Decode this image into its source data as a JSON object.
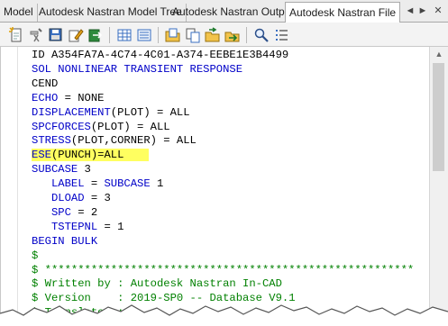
{
  "tabs": [
    {
      "label": "Model"
    },
    {
      "label": "Autodesk Nastran Model Tree"
    },
    {
      "label": "Autodesk Nastran Output"
    },
    {
      "label": "Autodesk Nastran File"
    }
  ],
  "tab_controls": {
    "prev": "◄",
    "next": "►",
    "close": "✕"
  },
  "toolbar": {
    "icons": [
      "new-file-icon",
      "run-analysis-icon",
      "save-icon",
      "edit-icon",
      "export-icon",
      "table-view-icon",
      "list-view-icon",
      "open-folder-icon",
      "copy-icon",
      "import-icon",
      "export-arrow-icon",
      "find-icon",
      "list-icon"
    ]
  },
  "editor": {
    "lines": [
      [
        {
          "t": "ID A354FA7A-4C74-4C01-A374-EEBE1E3B4499",
          "c": "plain"
        }
      ],
      [
        {
          "t": "SOL NONLINEAR TRANSIENT RESPONSE",
          "c": "kw"
        }
      ],
      [
        {
          "t": "CEND",
          "c": "plain"
        }
      ],
      [
        {
          "t": "ECHO",
          "c": "kw"
        },
        {
          "t": " = NONE",
          "c": "plain"
        }
      ],
      [
        {
          "t": "DISPLACEMENT",
          "c": "kw"
        },
        {
          "t": "(PLOT) = ALL",
          "c": "plain"
        }
      ],
      [
        {
          "t": "SPCFORCES",
          "c": "kw"
        },
        {
          "t": "(PLOT) = ALL",
          "c": "plain"
        }
      ],
      [
        {
          "t": "STRESS",
          "c": "kw"
        },
        {
          "t": "(PLOT,CORNER) = ALL",
          "c": "plain"
        }
      ],
      [
        {
          "t": "ESE",
          "c": "kw"
        },
        {
          "t": "(PUNCH)=ALL",
          "c": "plain"
        }
      ],
      [
        {
          "t": "SUBCASE",
          "c": "kw"
        },
        {
          "t": " 3",
          "c": "plain"
        }
      ],
      [
        {
          "t": "   LABEL",
          "c": "kw"
        },
        {
          "t": " = ",
          "c": "plain"
        },
        {
          "t": "SUBCASE",
          "c": "kw"
        },
        {
          "t": " 1",
          "c": "plain"
        }
      ],
      [
        {
          "t": "   DLOAD",
          "c": "kw"
        },
        {
          "t": " = 3",
          "c": "plain"
        }
      ],
      [
        {
          "t": "   SPC",
          "c": "kw"
        },
        {
          "t": " = 2",
          "c": "plain"
        }
      ],
      [
        {
          "t": "   TSTEPNL",
          "c": "kw"
        },
        {
          "t": " = 1",
          "c": "plain"
        }
      ],
      [
        {
          "t": "BEGIN BULK",
          "c": "kw"
        }
      ],
      [
        {
          "t": "$",
          "c": "cm"
        }
      ],
      [
        {
          "t": "$ ********************************************************",
          "c": "cm"
        }
      ],
      [
        {
          "t": "$ Written by : Autodesk Nastran In-CAD",
          "c": "cm"
        }
      ],
      [
        {
          "t": "$ Version    : 2019-SP0 -- Database V9.1",
          "c": "cm"
        }
      ],
      [
        {
          "t": "$ Translator : ",
          "c": "cm"
        }
      ]
    ],
    "highlight_color": "#ffff60"
  }
}
